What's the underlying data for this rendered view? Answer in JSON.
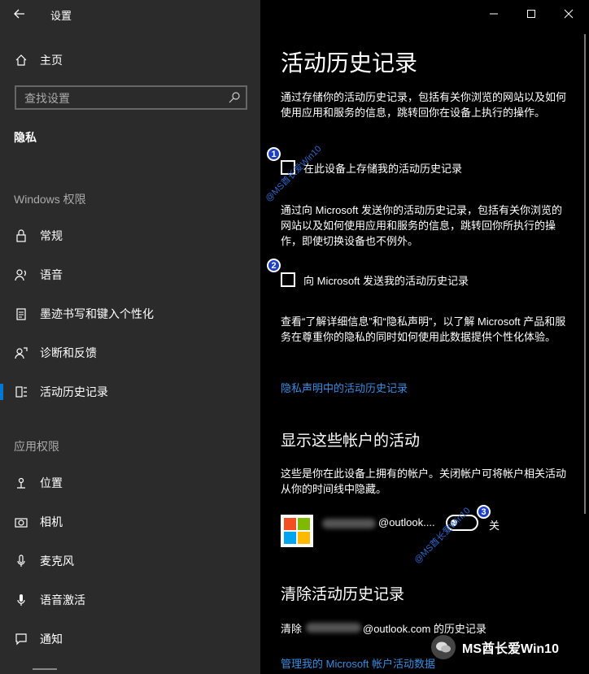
{
  "window": {
    "title": "设置"
  },
  "sidebar": {
    "home_label": "主页",
    "search_placeholder": "查找设置",
    "section_title": "隐私",
    "group_windows": "Windows 权限",
    "group_app": "应用权限",
    "windows_items": [
      {
        "label": "常规",
        "icon": "lock-icon"
      },
      {
        "label": "语音",
        "icon": "speech-icon"
      },
      {
        "label": "墨迹书写和键入个性化",
        "icon": "clipboard-icon"
      },
      {
        "label": "诊断和反馈",
        "icon": "feedback-icon"
      },
      {
        "label": "活动历史记录",
        "icon": "timeline-icon",
        "active": true
      }
    ],
    "app_items": [
      {
        "label": "位置",
        "icon": "location-icon"
      },
      {
        "label": "相机",
        "icon": "camera-icon"
      },
      {
        "label": "麦克风",
        "icon": "microphone-icon"
      },
      {
        "label": "语音激活",
        "icon": "voice-activation-icon"
      },
      {
        "label": "通知",
        "icon": "notification-icon"
      }
    ]
  },
  "main": {
    "title": "活动历史记录",
    "intro": "通过存储你的活动历史记录，包括有关你浏览的网站以及如何使用应用和服务的信息，跳转回你在设备上执行的操作。",
    "checkbox1_label": "在此设备上存储我的活动历史记录",
    "para2": "通过向 Microsoft 发送你的活动历史记录，包括有关你浏览的网站以及如何使用应用和服务的信息，跳转回你所执行的操作，即使切换设备也不例外。",
    "checkbox2_label": "向 Microsoft 发送我的活动历史记录",
    "para3": "查看“了解详细信息”和“隐私声明”，以了解 Microsoft 产品和服务在尊重你的隐私的同时如何使用此数据提供个性化体验。",
    "privacy_link": "隐私声明中的活动历史记录",
    "accounts_heading": "显示这些帐户的活动",
    "accounts_desc": "这些是你在此设备上拥有的帐户。关闭帐户可将帐户相关活动从你的时间线中隐藏。",
    "account_email_suffix": "@outlook....",
    "toggle_state": "关",
    "clear_heading": "清除活动历史记录",
    "clear_prefix": "清除",
    "clear_suffix": "@outlook.com 的历史记录",
    "manage_link": "管理我的 Microsoft 帐户活动数据"
  },
  "annotations": {
    "badge1": "1",
    "badge2": "2",
    "badge3": "3",
    "watermark_diag": "@MS酋长爱Win10",
    "watermark_bottom": "MS酋长爱Win10"
  },
  "colors": {
    "accent": "#0078d7",
    "link": "#3a8de0",
    "sidebar_bg": "#2b2b2b",
    "main_bg": "#000000"
  }
}
